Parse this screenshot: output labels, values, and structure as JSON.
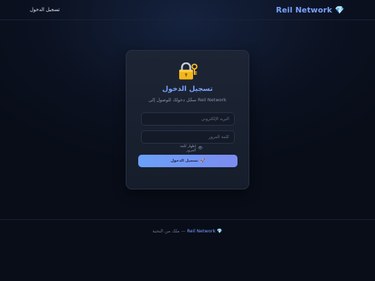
{
  "header": {
    "brand_name": "Reil Network",
    "brand_icon": "💎",
    "login_link": "تسجيل الدخول"
  },
  "login_card": {
    "icon": "🔐",
    "title": "تسجيل الدخول",
    "subtitle": "سجّل دخولك للوصول إلى Reil Network",
    "email_placeholder": "البريد الإلكتروني",
    "password_placeholder": "كلمة المرور",
    "show_password_label": "إظهار كلمة المرور",
    "show_password_icon": "👁",
    "submit_label": "تسجيل الدخول",
    "submit_icon": "🚀"
  },
  "footer": {
    "brand_icon": "💎",
    "brand_name": "Reil Network",
    "rights_text": "— ملك من النخبة"
  },
  "colors": {
    "accent": "#7aa2ff",
    "background": "#0b1120",
    "card": "#1b2232",
    "button_start": "#6aa0f8",
    "button_end": "#7c8df0"
  }
}
